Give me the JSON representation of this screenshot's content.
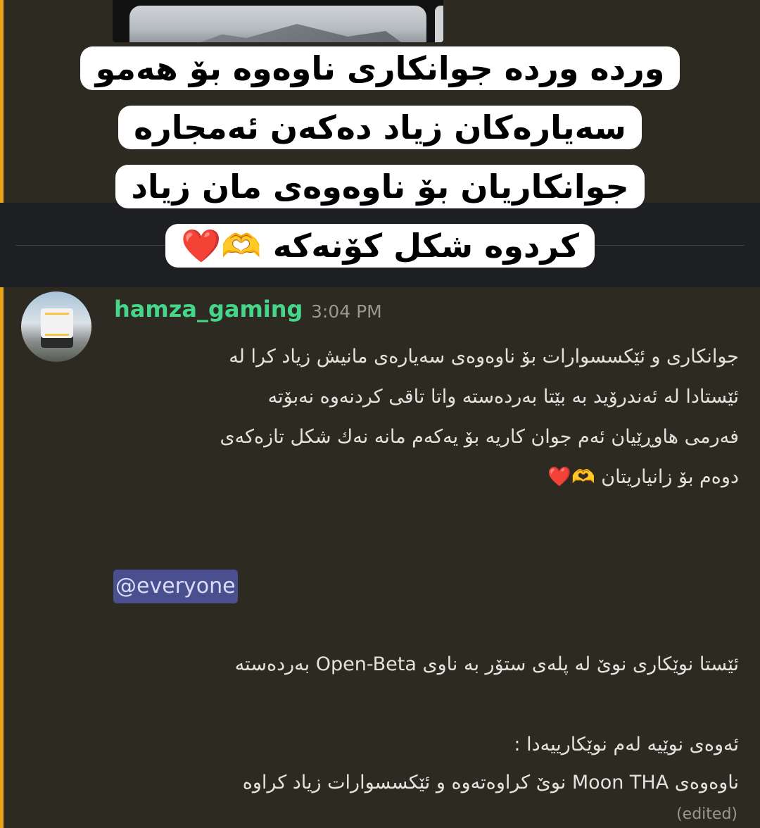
{
  "caption": {
    "lines": [
      "ورده ورده جوانكاری ناوه‌وه بۆ هه‌مو",
      "سه‌یاره‌كان زیاد ده‌كه‌ن ئه‌مجاره",
      "جوانكاریان بۆ ناوه‌وه‌ی مان زیاد",
      "كردوه شكل كۆنه‌كه"
    ],
    "emoji_hands": "🫶",
    "emoji_heart": "❤️"
  },
  "message": {
    "username": "hamza_gaming",
    "timestamp": "3:04 PM",
    "username_color": "#45d68a",
    "paragraph_lines": [
      "جوانكاری و ئێكسسوارات بۆ ناوه‌وه‌ی سه‌یاره‌ی مانیش زیاد كرا له",
      "ئێستادا له ئه‌ندرۆید به بێتا به‌رده‌سته واتا تاقی كردنه‌وه نه‌بۆته",
      "فه‌رمی هاوڕێیان ئه‌م جوان كاریه بۆ یه‌كه‌م مانه نه‌ك شكل تازه‌كه‌ی",
      "دوەم بۆ زانیاریتان"
    ],
    "paragraph_emoji_hands": "🫶",
    "paragraph_emoji_heart": "❤️",
    "mention": "@everyone",
    "open_beta_line": "ئێستا نوێكاری نوێ له پله‌ی ستۆر به ناوی Open-Beta به‌رده‌سته",
    "new_heading": "ئه‌وه‌ی نوێیه له‌م نوێكارییه‌دا :",
    "moon_line": "ناوه‌وه‌ی Moon THA نوێ كراوه‌ته‌وه و ئێكسسوارات زیاد كراوه",
    "edited_label": "(edited)"
  },
  "colors": {
    "background": "#2d2a22",
    "highlight_bar": "#e8a317",
    "mention_bg": "#4a4f8f"
  }
}
